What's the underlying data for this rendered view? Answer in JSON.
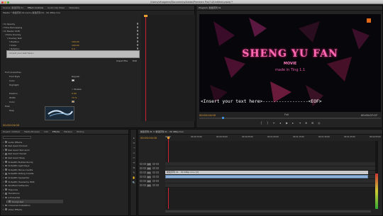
{
  "window": {
    "title": "/Users/vitragame/Documents/Adobe/Premiere Pro/7.0/Untitled.prproj *"
  },
  "effect_controls": {
    "tabs": [
      "Source: 新建序列 01",
      "Effect Controls",
      "Audio Clip Mixer",
      "Metadata"
    ],
    "clip_path": "Master * 新建序列 01.mp4 ▸ 新建序列 01 - 00 480p.mov",
    "rows": [
      {
        "label": "fx Opacity",
        "value": ""
      },
      {
        "label": "Time Remapping",
        "value": ""
      },
      {
        "label": "fx Master Shift",
        "value": ""
      },
      {
        "label": "Extra Overlay",
        "value": ""
      },
      {
        "label": "Overlay Text",
        "value": ""
      },
      {
        "label": "Position",
        "value": "100.00"
      },
      {
        "label": "Scale",
        "value": "100.00"
      },
      {
        "label": "Rotation",
        "value": "0.0"
      },
      {
        "label": "Text Color",
        "value": ""
      }
    ],
    "text_box": "<Insert your text here>",
    "reset_btn": "Import File",
    "edit_btn": "Edit",
    "props": [
      {
        "label": "Font properties",
        "value": ""
      },
      {
        "label": "Font Style",
        "value": "Regular"
      },
      {
        "label": "Color",
        "value": ""
      },
      {
        "label": "Highlight",
        "value": ""
      },
      {
        "label": "",
        "value": "✓ Enable"
      },
      {
        "label": "Position",
        "value": "0.00"
      },
      {
        "label": "Width",
        "value": "73 %"
      },
      {
        "label": "Color",
        "value": ""
      },
      {
        "label": "Help",
        "value": ""
      },
      {
        "label": "Help",
        "value": ""
      }
    ],
    "timecode": "00:00:04:00"
  },
  "program": {
    "tab": "Program: 新建序列 01",
    "title_text": "SHENG YU FAN",
    "movie_text": "MOVIE",
    "sub_text": "made in Ting 1.1",
    "overlay_text": "<Insert your text here>-----------------<EOF>",
    "timecode_left": "00:00:04:00",
    "fit": "Full",
    "timecode_right": "00:00:07:07"
  },
  "project": {
    "tabs": [
      "Project: Untitled",
      "Media Browser",
      "Info",
      "Effects",
      "Markers",
      "History"
    ],
    "items": [
      "Audio Effects",
      "Red Giant Product",
      "Red Giant Text Anim",
      "Red Giant Transit",
      "Red Giant Warp",
      "SUGARfx Bubble Rundy",
      "SUGARfx Light Rays",
      "SUGARfx Movie Credits",
      "SUGARfx Rolling Credits",
      "SUGARfx Typewriter",
      "SUGARfx Headache HDR",
      "Shotfield Softworks",
      "Trapcode",
      "Transitions",
      "a.Presental",
      "Young User",
      "Universal Installation",
      "Video Effects"
    ]
  },
  "timeline": {
    "tab": "新建序列 01 ✕ 新建序列 01 - 00 480p.mov",
    "timecode": "00:00:04:00",
    "ruler": [
      "00:00",
      "00:00:15:00",
      "00:00:30:00",
      "00:00:45:00",
      "00:01:00:00",
      "00:01:15:00",
      "00:01:30:00",
      "00:01:45:00",
      "00:02:00:00"
    ],
    "tracks": [
      "V3",
      "V2",
      "V1",
      "A1",
      "A2",
      "A3"
    ],
    "clip_label": "新建序列 01 - 00 480p.mov [V]"
  },
  "tools": [
    "▸",
    "⇔",
    "⇢",
    "◇",
    "✂",
    "↔",
    "⇆",
    "✎",
    "✋",
    "🔍"
  ]
}
